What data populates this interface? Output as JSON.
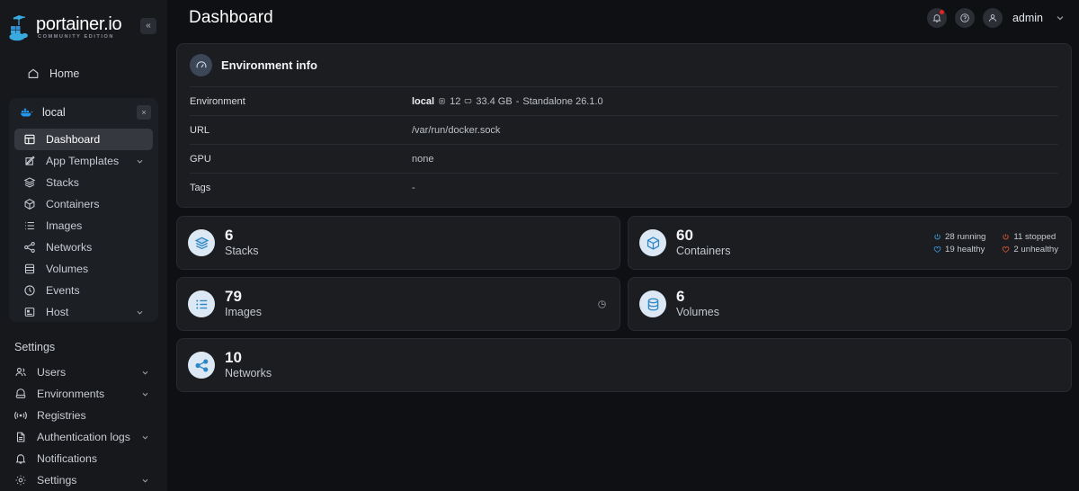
{
  "brand": {
    "name": "portainer.io",
    "edition": "COMMUNITY EDITION",
    "logo_icon": "portainer-logo-icon",
    "collapse_label": "«"
  },
  "sidebar": {
    "home": {
      "label": "Home",
      "icon": "home-icon"
    },
    "environment": {
      "name": "local",
      "icon": "docker-whale-icon",
      "close_label": "×"
    },
    "env_items": [
      {
        "label": "Dashboard",
        "icon": "dashboard-icon",
        "active": true,
        "expandable": false
      },
      {
        "label": "App Templates",
        "icon": "template-edit-icon",
        "active": false,
        "expandable": true
      },
      {
        "label": "Stacks",
        "icon": "stacks-layers-icon",
        "active": false,
        "expandable": false
      },
      {
        "label": "Containers",
        "icon": "container-box-icon",
        "active": false,
        "expandable": false
      },
      {
        "label": "Images",
        "icon": "images-list-icon",
        "active": false,
        "expandable": false
      },
      {
        "label": "Networks",
        "icon": "network-share-icon",
        "active": false,
        "expandable": false
      },
      {
        "label": "Volumes",
        "icon": "volume-database-icon",
        "active": false,
        "expandable": false
      },
      {
        "label": "Events",
        "icon": "events-clock-icon",
        "active": false,
        "expandable": false
      },
      {
        "label": "Host",
        "icon": "host-server-icon",
        "active": false,
        "expandable": true
      }
    ],
    "settings_heading": "Settings",
    "settings_items": [
      {
        "label": "Users",
        "icon": "users-icon",
        "expandable": true
      },
      {
        "label": "Environments",
        "icon": "environments-icon",
        "expandable": true
      },
      {
        "label": "Registries",
        "icon": "registries-icon",
        "expandable": false
      },
      {
        "label": "Authentication logs",
        "icon": "auth-logs-file-icon",
        "expandable": true
      },
      {
        "label": "Notifications",
        "icon": "notifications-bell-icon",
        "expandable": false
      },
      {
        "label": "Settings",
        "icon": "settings-gear-icon",
        "expandable": true
      }
    ]
  },
  "header": {
    "title": "Dashboard",
    "notifications_icon": "bell-icon",
    "has_notification_dot": true,
    "help_icon": "help-circle-icon",
    "avatar_icon": "user-avatar-icon",
    "user": "admin",
    "caret_icon": "chevron-down-icon"
  },
  "environment_info": {
    "title": "Environment info",
    "icon": "gauge-icon",
    "rows": [
      {
        "key": "Environment",
        "value_name": "local",
        "cpu_icon": "cpu-icon",
        "cpu": "12",
        "memory_icon": "memory-icon",
        "memory": "33.4 GB",
        "separator": "-",
        "engine": "Standalone 26.1.0"
      },
      {
        "key": "URL",
        "value": "/var/run/docker.sock"
      },
      {
        "key": "GPU",
        "value": "none"
      },
      {
        "key": "Tags",
        "value": "-"
      }
    ]
  },
  "stats": {
    "stacks": {
      "count": "6",
      "label": "Stacks",
      "icon": "stacks-layers-icon"
    },
    "containers": {
      "count": "60",
      "label": "Containers",
      "icon": "container-box-icon",
      "badges": [
        {
          "icon": "power-icon",
          "text": "28 running",
          "color": "#3b9bdb"
        },
        {
          "icon": "power-off-icon",
          "text": "11 stopped",
          "color": "#d9573a"
        },
        {
          "icon": "heart-icon",
          "text": "19 healthy",
          "color": "#3b9bdb"
        },
        {
          "icon": "heart-broken-icon",
          "text": "2 unhealthy",
          "color": "#d9573a"
        }
      ]
    },
    "images": {
      "count": "79",
      "label": "Images",
      "icon": "images-list-icon",
      "size_icon": "pie-clock-icon"
    },
    "volumes": {
      "count": "6",
      "label": "Volumes",
      "icon": "volume-database-icon"
    },
    "networks": {
      "count": "10",
      "label": "Networks",
      "icon": "network-share-icon"
    }
  },
  "colors": {
    "accent": "#3b9bdb",
    "danger": "#d9573a",
    "page_bg": "#0f1013",
    "card_bg": "#1b1d21",
    "sidebar_bg": "#16181c"
  }
}
